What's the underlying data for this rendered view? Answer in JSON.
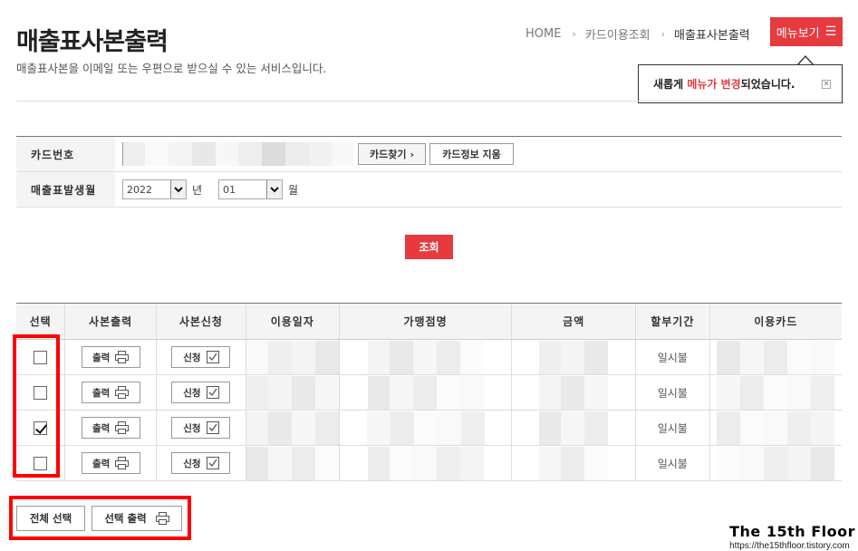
{
  "header": {
    "title": "매출표사본출력",
    "description": "매출표사본을 이메일 또는 우편으로 받으실 수 있는 서비스입니다."
  },
  "breadcrumb": {
    "items": [
      "HOME",
      "카드이용조회",
      "매출표사본출력"
    ]
  },
  "menu_button": {
    "label": "메뉴보기",
    "icon": "hamburger-icon"
  },
  "notice": {
    "prefix": "새롭게 ",
    "highlight": "메뉴가 변경",
    "suffix": "되었습니다.",
    "close_icon": "close-icon"
  },
  "form": {
    "card_number_label": "카드번호",
    "find_card_label": "카드찾기",
    "find_card_arrow": "›",
    "clear_card_label": "카드정보 지움",
    "issue_month_label": "매출표발생월",
    "year_value": "2022",
    "year_unit": "년",
    "month_value": "01",
    "month_unit": "월"
  },
  "search_button": {
    "label": "조회"
  },
  "table": {
    "headers": [
      "선택",
      "사본출력",
      "사본신청",
      "이용일자",
      "가맹점명",
      "금액",
      "할부기간",
      "이용카드"
    ],
    "print_label": "출력",
    "request_label": "신청",
    "rows": [
      {
        "checked": false,
        "installment": "일시불"
      },
      {
        "checked": false,
        "installment": "일시불"
      },
      {
        "checked": true,
        "installment": "일시불"
      },
      {
        "checked": false,
        "installment": "일시불"
      }
    ]
  },
  "bottom_actions": {
    "select_all_label": "전체 선택",
    "print_selected_label": "선택 출력"
  },
  "watermark": {
    "title": "The 15th Floor",
    "url": "https://the15thfloor.tistory.com"
  },
  "colors": {
    "accent": "#e63a3f",
    "highlight_frame": "#ff0000"
  }
}
